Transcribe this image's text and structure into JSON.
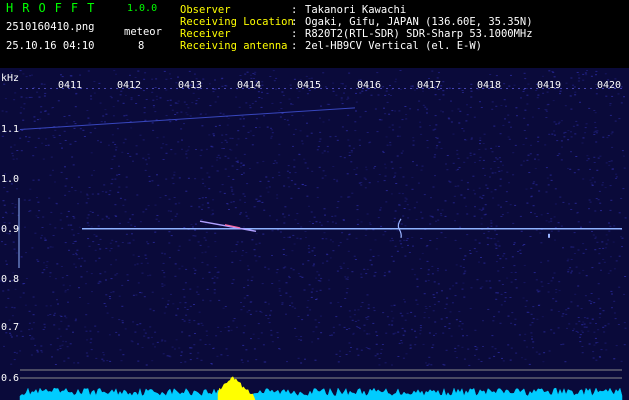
{
  "app": {
    "name": "HROFFT",
    "version": "1.0.0"
  },
  "file": {
    "name": "2510160410.png",
    "datetime": "25.10.16 04:10"
  },
  "meteor": {
    "label": "meteor",
    "count": "8"
  },
  "info": [
    {
      "key": "Observer",
      "value": "Takanori Kawachi"
    },
    {
      "key": "Receiving Location",
      "value": "Ogaki, Gifu, JAPAN (136.60E, 35.35N)"
    },
    {
      "key": "Receiver",
      "value": "R820T2(RTL-SDR) SDR-Sharp 53.1000MHz"
    },
    {
      "key": "Receiving antenna",
      "value": "2el-HB9CV Vertical (el. E-W)"
    }
  ],
  "chart_data": {
    "type": "heatmap",
    "ylabel": "kHz",
    "y_ticks": [
      "1.1",
      "1.0",
      "0.9",
      "0.8",
      "0.7",
      "0.6"
    ],
    "x_ticks": [
      "0411",
      "0412",
      "0413",
      "0414",
      "0415",
      "0416",
      "0417",
      "0418",
      "0419",
      "0420"
    ],
    "carrier_khz": 0.9,
    "colors": {
      "background": "#0a0a3a",
      "noise": "#3030b0",
      "carrier": "#8fb2ff",
      "power": "#00ccff",
      "power_peak": "#ffff00"
    }
  }
}
